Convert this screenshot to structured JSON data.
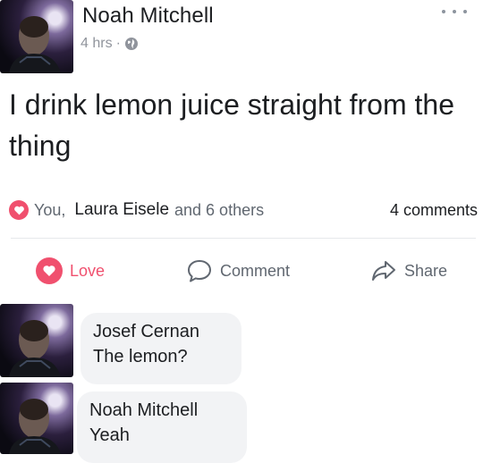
{
  "post": {
    "author": "Noah Mitchell",
    "time": "4 hrs",
    "separator": "·",
    "privacy_icon": "globe-icon",
    "more_icon": "more-options-icon",
    "text": "I drink lemon juice straight from the thing"
  },
  "reactions": {
    "reaction_icon": "love-reaction-icon",
    "you": "You,",
    "highlight_name": "Laura Eisele",
    "others": "and 6 others",
    "comments_count": "4 comments"
  },
  "actions": {
    "love": "Love",
    "comment": "Comment",
    "share": "Share"
  },
  "comments": [
    {
      "author": "Josef Cernan",
      "text": "The lemon?"
    },
    {
      "author": "Noah Mitchell",
      "text": "Yeah"
    }
  ],
  "colors": {
    "love": "#f0506e",
    "secondary_text": "#606770",
    "bubble": "#f2f3f5"
  }
}
